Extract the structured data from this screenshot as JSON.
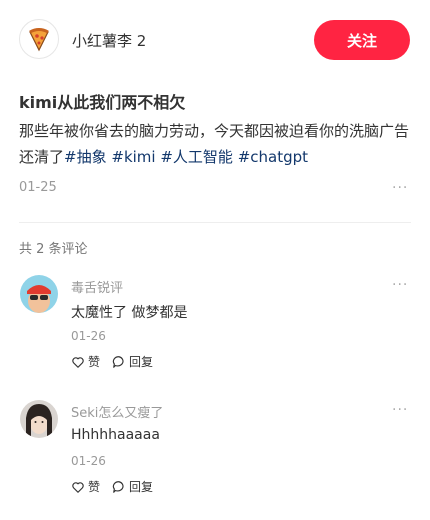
{
  "author": {
    "name": "小红薯李 2",
    "avatar_icon": "pizza-icon"
  },
  "follow_label": "关注",
  "post": {
    "title": "kimi从此我们两不相欠",
    "text": "那些年被你省去的脑力劳动，今天都因被迫看你的洗脑广告还清了",
    "tags": [
      "#抽象",
      "#kimi",
      "#人工智能",
      "#chatgpt"
    ],
    "date": "01-25",
    "more": "···"
  },
  "comments_header": "共 2 条评论",
  "comments": [
    {
      "name": "毒舌锐评",
      "text": "太魔性了 做梦都是",
      "date": "01-26",
      "like": "赞",
      "reply": "回复",
      "more": "···"
    },
    {
      "name": "Seki怎么又瘦了",
      "text": "Hhhhhaaaaa",
      "date": "01-26",
      "like": "赞",
      "reply": "回复",
      "more": "···"
    }
  ],
  "colors": {
    "accent": "#ff2442",
    "tag": "#13386c"
  }
}
